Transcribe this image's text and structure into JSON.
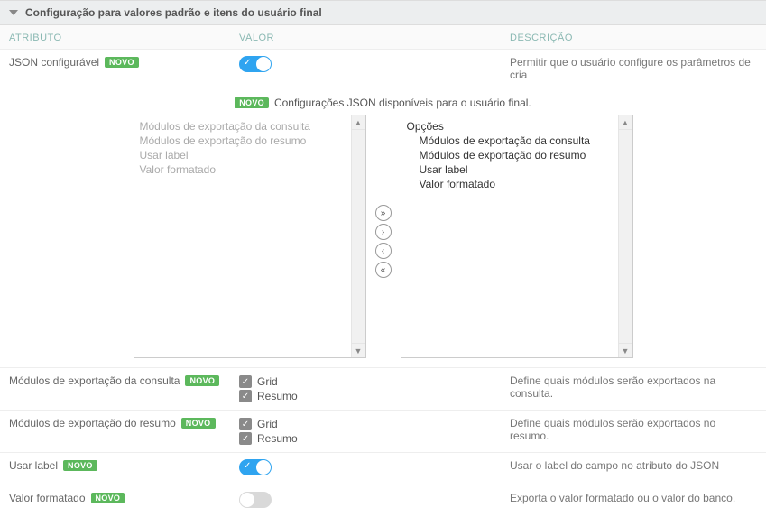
{
  "section_title": "Configuração para valores padrão e itens do usuário final",
  "headers": {
    "attr": "ATRIBUTO",
    "val": "VALOR",
    "desc": "DESCRIÇÃO"
  },
  "badge_novo": "NOVO",
  "rows": {
    "json_config": {
      "label": "JSON configurável",
      "toggle_on": true,
      "desc": "Permitir que o usuário configure os parâmetros de cria"
    },
    "exp_consulta": {
      "label": "Módulos de exportação da consulta",
      "opts": {
        "grid": "Grid",
        "resumo": "Resumo"
      },
      "desc": "Define quais módulos serão exportados na consulta."
    },
    "exp_resumo": {
      "label": "Módulos de exportação do resumo",
      "opts": {
        "grid": "Grid",
        "resumo": "Resumo"
      },
      "desc": "Define quais módulos serão exportados no resumo."
    },
    "usar_label": {
      "label": "Usar label",
      "toggle_on": true,
      "desc": "Usar o label do campo no atributo do JSON"
    },
    "valor_formatado": {
      "label": "Valor formatado",
      "toggle_on": false,
      "desc": "Exporta o valor formatado ou o valor do banco."
    }
  },
  "info_text": "Configurações JSON disponíveis para o usuário final.",
  "left_items": [
    "Módulos de exportação da consulta",
    "Módulos de exportação do resumo",
    "Usar label",
    "Valor formatado"
  ],
  "right_root": "Opções",
  "right_items": [
    "Módulos de exportação da consulta",
    "Módulos de exportação do resumo",
    "Usar label",
    "Valor formatado"
  ]
}
